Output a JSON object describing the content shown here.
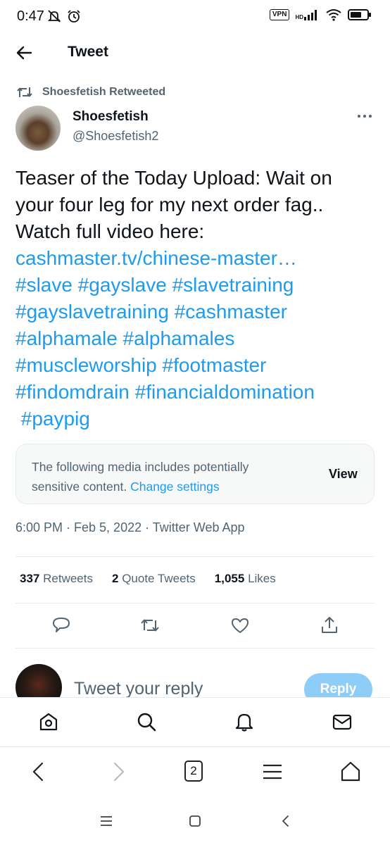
{
  "status_bar": {
    "time": "0:47",
    "vpn": "VPN",
    "network": "HD"
  },
  "header": {
    "title": "Tweet"
  },
  "retweet_context": {
    "label": "Shoesfetish Retweeted"
  },
  "author": {
    "name": "Shoesfetish",
    "handle": "@Shoesfetish2"
  },
  "tweet": {
    "line1": "Teaser of the Today Upload: Wait on",
    "line2": "your four leg for my next order fag..",
    "line3": "Watch full video here:",
    "link": "cashmaster.tv/chinese-master…",
    "hashtags_line1": "#slave #gayslave #slavetraining",
    "hashtags_line2": "#gayslavetraining #cashmaster",
    "hashtags_line3": "#alphamale #alphamales",
    "hashtags_line4": "#muscleworship #footmaster",
    "hashtags_line5": "#findomdrain #financialdomination",
    "hashtags_line6": " #paypig"
  },
  "sensitive_notice": {
    "text": "The following media includes potentially sensitive content.",
    "settings_link": "Change settings",
    "view_label": "View"
  },
  "timestamp": "6:00 PM · Feb 5, 2022 · Twitter Web App",
  "stats": {
    "retweets_count": "337",
    "retweets_label": "Retweets",
    "quotes_count": "2",
    "quotes_label": "Quote Tweets",
    "likes_count": "1,055",
    "likes_label": "Likes"
  },
  "reply_composer": {
    "placeholder": "Tweet your reply",
    "reply_label": "Reply"
  },
  "browser_bar": {
    "tab_count": "2"
  },
  "colors": {
    "accent": "#1d9bf0",
    "secondary_text": "#536471",
    "reply_button": "#8ecdf8"
  }
}
